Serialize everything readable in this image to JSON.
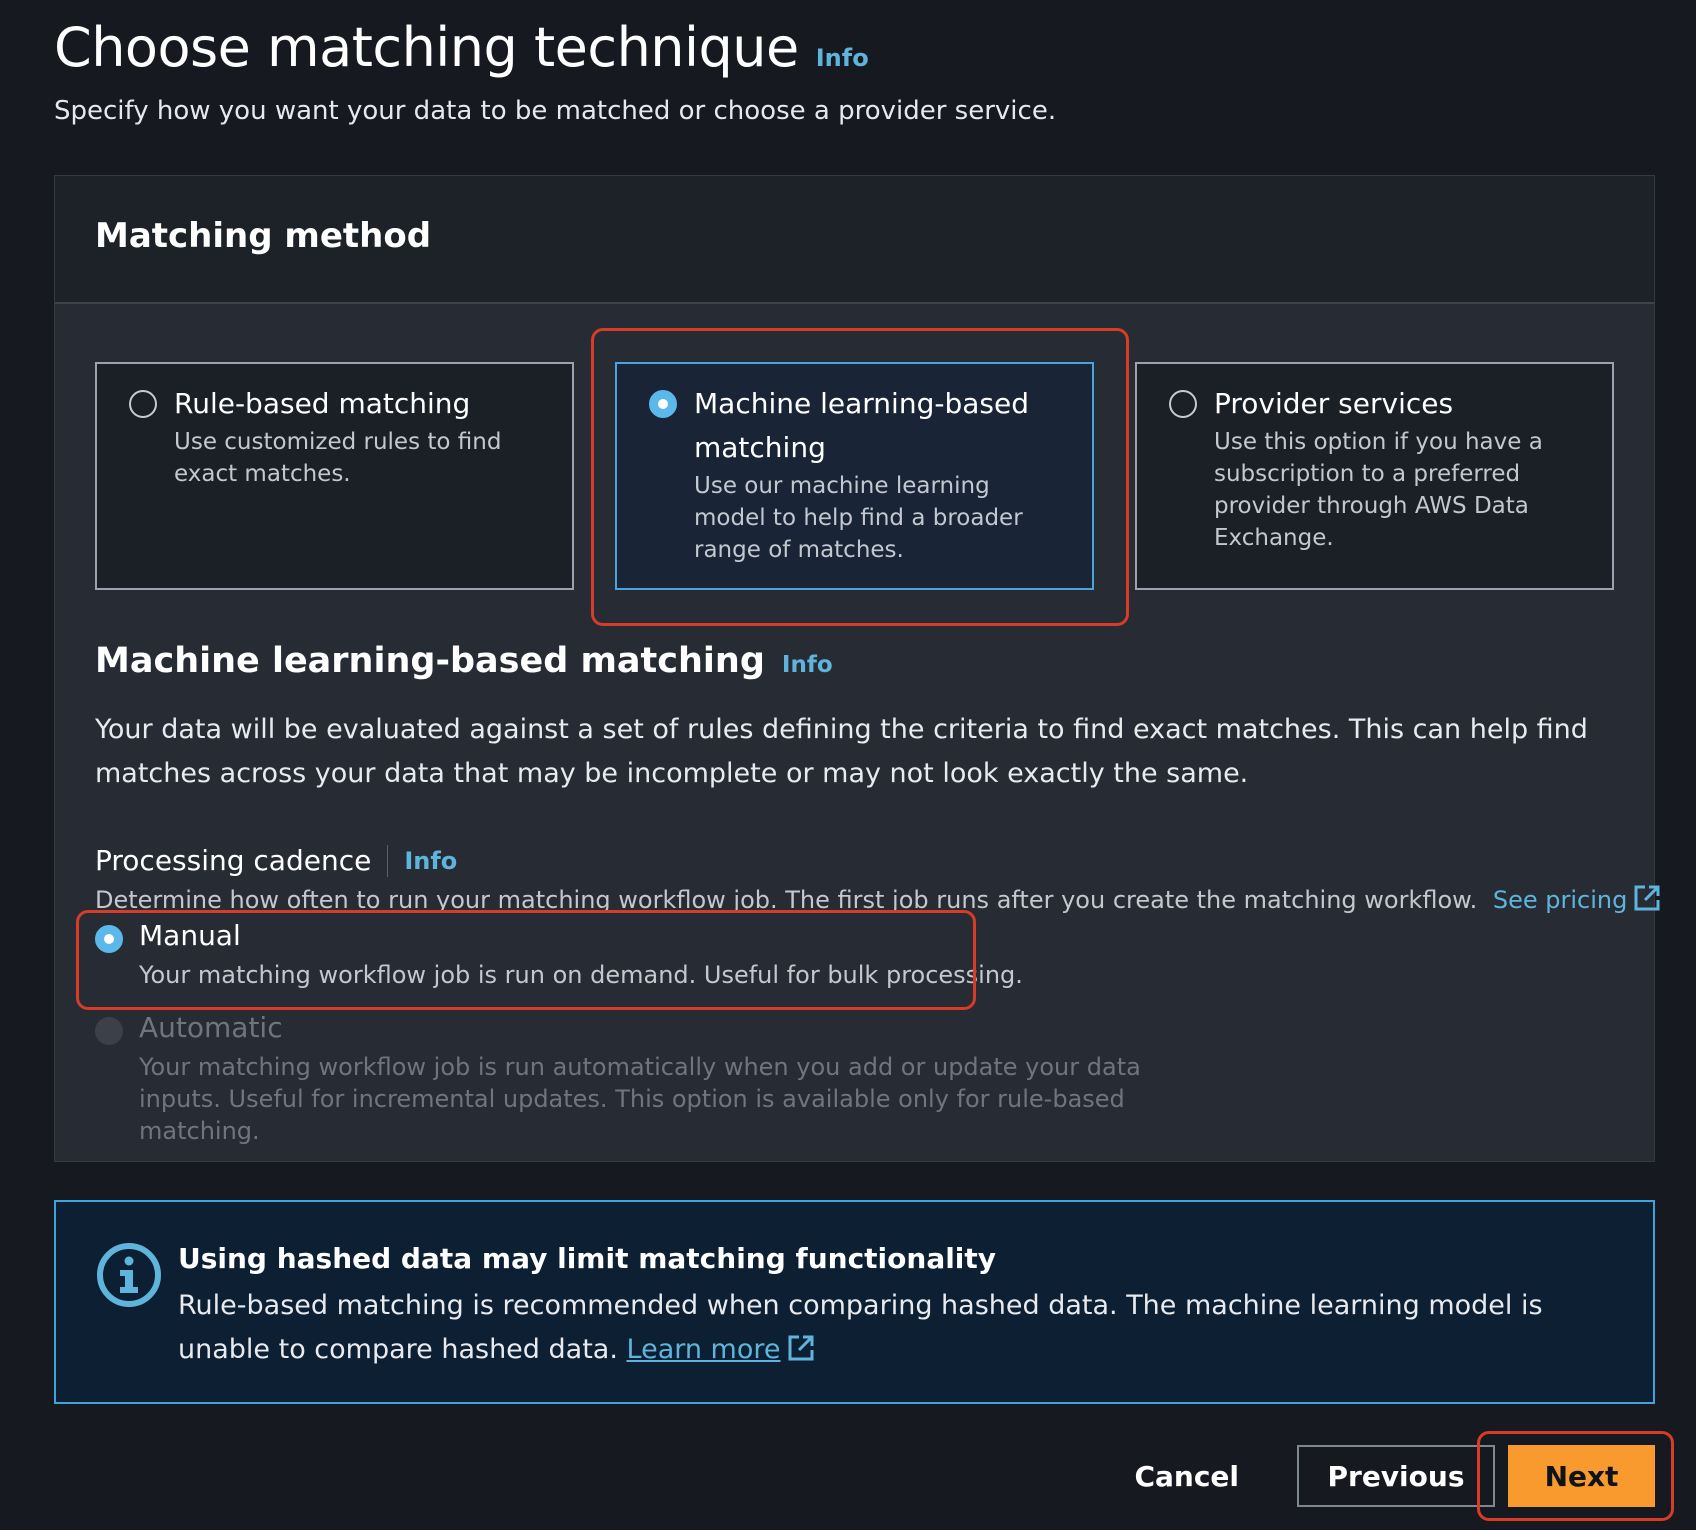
{
  "page": {
    "title": "Choose matching technique",
    "title_info": "Info",
    "description": "Specify how you want your data to be matched or choose a provider service."
  },
  "matching_method": {
    "heading": "Matching method",
    "options": [
      {
        "title": "Rule-based matching",
        "description": "Use customized rules to find exact matches.",
        "selected": false
      },
      {
        "title": "Machine learning-based matching",
        "description": "Use our machine learning model to help find a broader range of matches.",
        "selected": true
      },
      {
        "title": "Provider services",
        "description": "Use this option if you have a subscription to a preferred provider through AWS Data Exchange.",
        "selected": false
      }
    ]
  },
  "ml_section": {
    "title": "Machine learning-based matching",
    "info": "Info",
    "description": "Your data will be evaluated against a set of rules defining the criteria to find exact matches. This can help find matches across your data that may be incomplete or may not look exactly the same."
  },
  "cadence": {
    "label": "Processing cadence",
    "info": "Info",
    "description": "Determine how often to run your matching workflow job. The first job runs after you create the matching workflow.",
    "see_pricing": "See pricing",
    "options": [
      {
        "label": "Manual",
        "description": "Your matching workflow job is run on demand. Useful for bulk processing.",
        "selected": true,
        "disabled": false
      },
      {
        "label": "Automatic",
        "description": "Your matching workflow job is run automatically when you add or update your data inputs. Useful for incremental updates. This option is available only for rule-based matching.",
        "selected": false,
        "disabled": true
      }
    ]
  },
  "alert": {
    "title": "Using hashed data may limit matching functionality",
    "body": "Rule-based matching is recommended when comparing hashed data. The machine learning model is unable to compare hashed data.",
    "learn_more": "Learn more"
  },
  "actions": {
    "cancel": "Cancel",
    "previous": "Previous",
    "next": "Next"
  },
  "colors": {
    "accent": "#5fb4dc",
    "primary_button": "#f89a2e",
    "highlight": "#d83b26"
  }
}
